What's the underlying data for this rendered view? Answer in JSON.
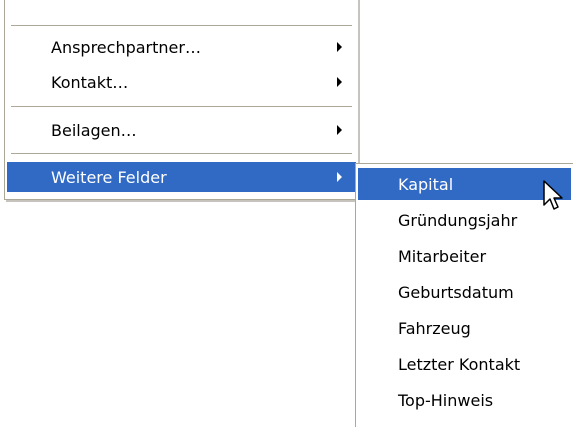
{
  "main_menu": {
    "items": [
      {
        "label": "Ansprechpartner…",
        "has_submenu": true
      },
      {
        "label": "Kontakt…",
        "has_submenu": true
      },
      {
        "label": "Beilagen…",
        "has_submenu": true
      },
      {
        "label": "Weitere Felder",
        "has_submenu": true,
        "highlighted": true
      }
    ]
  },
  "submenu": {
    "items": [
      {
        "label": "Kapital",
        "highlighted": true
      },
      {
        "label": "Gründungsjahr"
      },
      {
        "label": "Mitarbeiter"
      },
      {
        "label": "Geburtsdatum"
      },
      {
        "label": "Fahrzeug"
      },
      {
        "label": "Letzter Kontakt"
      },
      {
        "label": "Top-Hinweis"
      }
    ]
  },
  "colors": {
    "highlight": "#316ac5",
    "highlight_text": "#ffffff",
    "separator": "#aca899"
  },
  "icons": {
    "submenu_arrow": "chevron-right-icon",
    "cursor": "mouse-pointer-icon"
  }
}
